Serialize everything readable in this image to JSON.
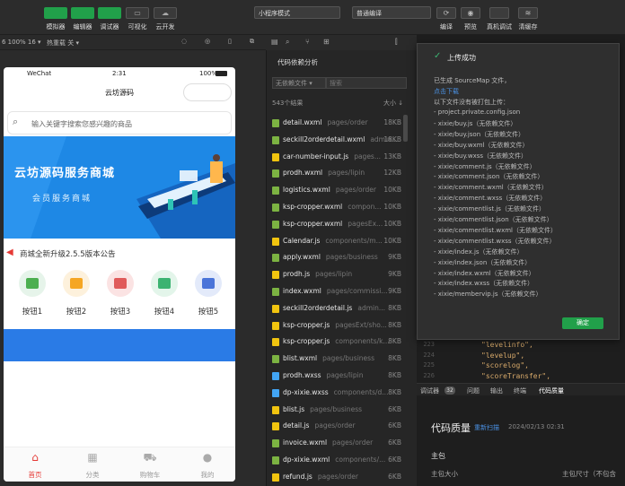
{
  "toolbar": {
    "buttons": [
      {
        "label": "模拟器"
      },
      {
        "label": "编辑器"
      },
      {
        "label": "调试器"
      },
      {
        "label": "可视化"
      },
      {
        "label": "云开发"
      }
    ],
    "mode_select": "小程序模式",
    "compile_select": "普通编译",
    "right_buttons": [
      {
        "label": "编译"
      },
      {
        "label": "预览"
      },
      {
        "label": "真机调试"
      },
      {
        "label": "清缓存"
      }
    ]
  },
  "simulator_bar": {
    "device": "6 100% 16 ▾",
    "hotreload": "热重载 关 ▾"
  },
  "phone": {
    "status_left": "WeChat",
    "status_time": "2:31",
    "status_battery": "100%",
    "title": "云坊源码",
    "search_placeholder": "输入关键字搜索您感兴趣的商品",
    "banner_title": "云坊源码服务商城",
    "banner_subtitle": "会员服务商城",
    "notice": "商城全新升级2.5.5版本公告",
    "grid": [
      {
        "label": "按钮1",
        "icon": "mountain-icon",
        "color": "#4caf50",
        "bg": "#e6f4ea"
      },
      {
        "label": "按钮2",
        "icon": "bag-icon",
        "color": "#f5a623",
        "bg": "#fdf1dc"
      },
      {
        "label": "按钮3",
        "icon": "ticket-icon",
        "color": "#e05a5a",
        "bg": "#fbe3e3"
      },
      {
        "label": "按钮4",
        "icon": "stack-icon",
        "color": "#3cb371",
        "bg": "#e3f5ea"
      },
      {
        "label": "按钮5",
        "icon": "truck-icon",
        "color": "#4a74d9",
        "bg": "#e3eafa"
      }
    ],
    "tabs": [
      {
        "label": "首页",
        "icon": "home-icon",
        "active": true
      },
      {
        "label": "分类",
        "icon": "grid-icon",
        "active": false
      },
      {
        "label": "购物车",
        "icon": "cart-icon",
        "active": false
      },
      {
        "label": "我的",
        "icon": "user-icon",
        "active": false
      }
    ]
  },
  "file_panel": {
    "title": "代码依赖分析",
    "filter_select": "无依赖文件 ▾",
    "search_placeholder": "搜索",
    "result_count": "543个结果",
    "sort_label": "大小 ↓",
    "files": [
      {
        "name": "detail.wxml",
        "path": "pages/order",
        "size": "18KB",
        "type": "wxml"
      },
      {
        "name": "seckill2orderdetail.wxml",
        "path": "admin...",
        "size": "18KB",
        "type": "wxml"
      },
      {
        "name": "car-number-input.js",
        "path": "pages...",
        "size": "13KB",
        "type": "js"
      },
      {
        "name": "prodh.wxml",
        "path": "pages/lipin",
        "size": "12KB",
        "type": "wxml"
      },
      {
        "name": "logistics.wxml",
        "path": "pages/order",
        "size": "10KB",
        "type": "wxml"
      },
      {
        "name": "ksp-cropper.wxml",
        "path": "compon...",
        "size": "10KB",
        "type": "wxml"
      },
      {
        "name": "ksp-cropper.wxml",
        "path": "pagesEx...",
        "size": "10KB",
        "type": "wxml"
      },
      {
        "name": "Calendar.js",
        "path": "components/m...",
        "size": "10KB",
        "type": "js"
      },
      {
        "name": "apply.wxml",
        "path": "pages/business",
        "size": "9KB",
        "type": "wxml"
      },
      {
        "name": "prodh.js",
        "path": "pages/lipin",
        "size": "9KB",
        "type": "js"
      },
      {
        "name": "index.wxml",
        "path": "pages/commissi...",
        "size": "9KB",
        "type": "wxml"
      },
      {
        "name": "seckill2orderdetail.js",
        "path": "admin...",
        "size": "8KB",
        "type": "js"
      },
      {
        "name": "ksp-cropper.js",
        "path": "pagesExt/sho...",
        "size": "8KB",
        "type": "js"
      },
      {
        "name": "ksp-cropper.js",
        "path": "components/k...",
        "size": "8KB",
        "type": "js"
      },
      {
        "name": "blist.wxml",
        "path": "pages/business",
        "size": "8KB",
        "type": "wxml"
      },
      {
        "name": "prodh.wxss",
        "path": "pages/lipin",
        "size": "8KB",
        "type": "wxss"
      },
      {
        "name": "dp-xixie.wxss",
        "path": "components/d...",
        "size": "8KB",
        "type": "wxss"
      },
      {
        "name": "blist.js",
        "path": "pages/business",
        "size": "6KB",
        "type": "js"
      },
      {
        "name": "detail.js",
        "path": "pages/order",
        "size": "6KB",
        "type": "js"
      },
      {
        "name": "invoice.wxml",
        "path": "pages/order",
        "size": "6KB",
        "type": "wxml"
      },
      {
        "name": "dp-xixie.wxml",
        "path": "components/...",
        "size": "6KB",
        "type": "wxml"
      },
      {
        "name": "refund.js",
        "path": "pages/order",
        "size": "6KB",
        "type": "js"
      }
    ]
  },
  "upload_popup": {
    "title": "上传成功",
    "line1": "已生成 SourceMap 文件，",
    "link": "点击下载",
    "line2": "以下文件没有被打包上传：",
    "items": [
      "- project.private.config.json",
      "- xixie/buy.js（无依赖文件）",
      "- xixie/buy.json（无依赖文件）",
      "- xixie/buy.wxml（无依赖文件）",
      "- xixie/buy.wxss（无依赖文件）",
      "- xixie/comment.js（无依赖文件）",
      "- xixie/comment.json（无依赖文件）",
      "- xixie/comment.wxml（无依赖文件）",
      "- xixie/comment.wxss（无依赖文件）",
      "- xixie/commentlist.js（无依赖文件）",
      "- xixie/commentlist.json（无依赖文件）",
      "- xixie/commentlist.wxml（无依赖文件）",
      "- xixie/commentlist.wxss（无依赖文件）",
      "- xixie/index.js（无依赖文件）",
      "- xixie/index.json（无依赖文件）",
      "- xixie/index.wxml（无依赖文件）",
      "- xixie/index.wxss（无依赖文件）",
      "- xixie/membervip.js（无依赖文件）"
    ],
    "confirm": "确定"
  },
  "code": {
    "lines": [
      {
        "num": "223",
        "text": "\"levelinfo\","
      },
      {
        "num": "224",
        "text": "\"levelup\","
      },
      {
        "num": "225",
        "text": "\"scorelog\","
      },
      {
        "num": "226",
        "text": "\"scoreTransfer\","
      }
    ]
  },
  "bottom_panel": {
    "tabs": [
      {
        "label": "调试器",
        "badge": "32"
      },
      {
        "label": "问题"
      },
      {
        "label": "输出"
      },
      {
        "label": "终端"
      },
      {
        "label": "代码质量",
        "active": true
      }
    ],
    "heading": "代码质量",
    "rescan": "重新扫描",
    "date": "2024/02/13 02:31",
    "section": "主包",
    "size_label": "主包大小",
    "size_right": "主包尺寸（不包含"
  }
}
